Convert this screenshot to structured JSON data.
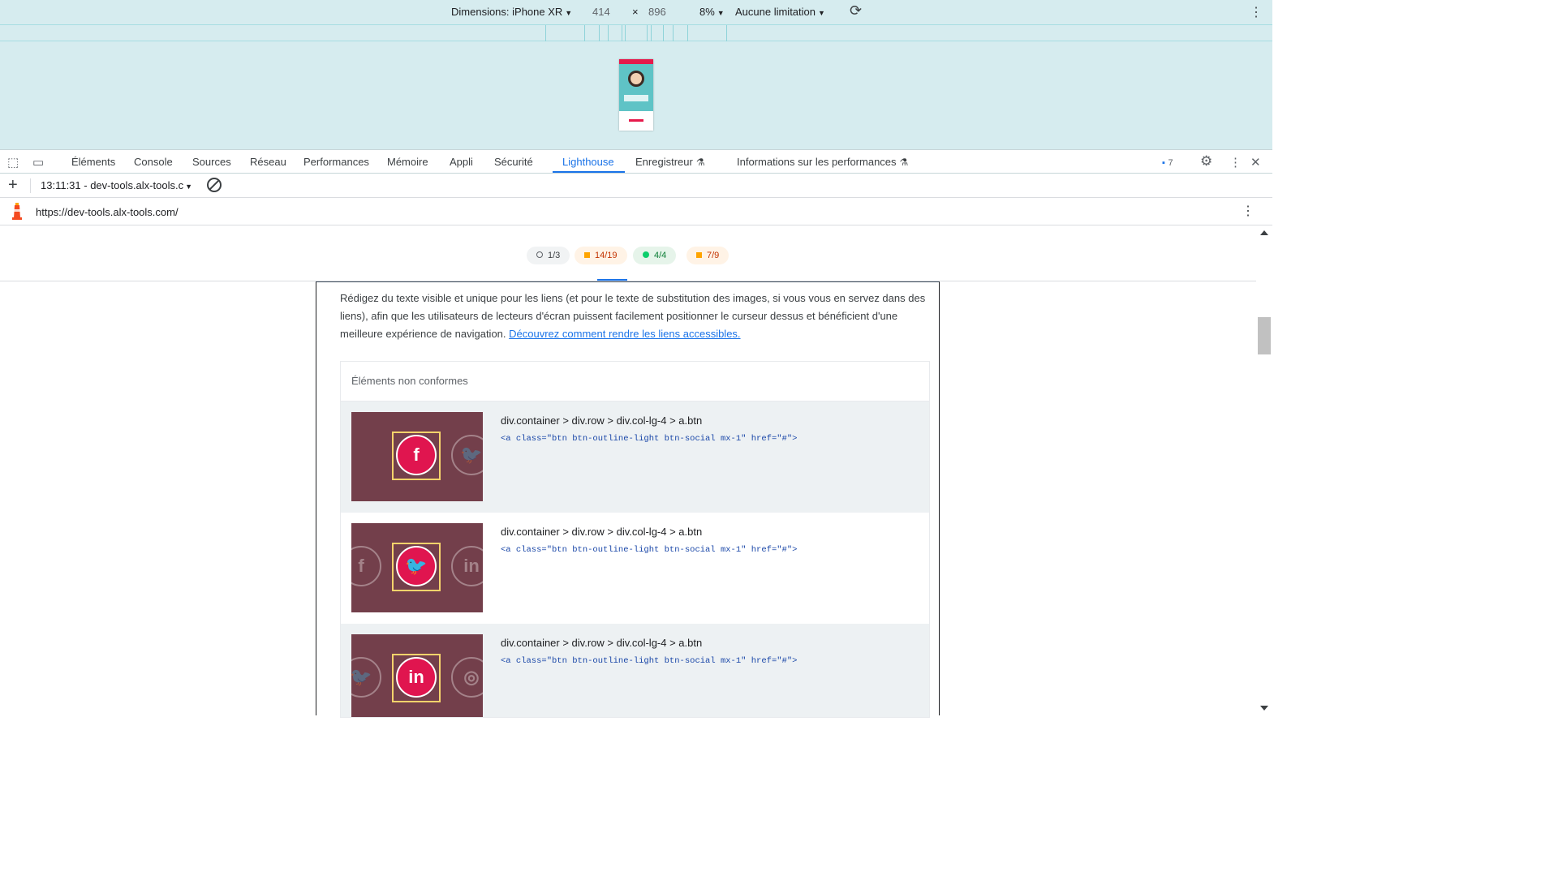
{
  "device_toolbar": {
    "dimensions_label": "Dimensions: iPhone XR",
    "width": "414",
    "times": "×",
    "height": "896",
    "zoom": "8%",
    "throttle": "Aucune limitation",
    "icons": [
      "rotate-icon",
      "more-vert-icon"
    ]
  },
  "tabs": [
    {
      "label": "Éléments"
    },
    {
      "label": "Console"
    },
    {
      "label": "Sources"
    },
    {
      "label": "Réseau"
    },
    {
      "label": "Performances"
    },
    {
      "label": "Mémoire"
    },
    {
      "label": "Appli"
    },
    {
      "label": "Sécurité"
    },
    {
      "label": "Lighthouse",
      "active": true
    },
    {
      "label": "Enregistreur"
    },
    {
      "label": "Informations sur les performances"
    }
  ],
  "issues_count": "7",
  "lighthouse_toolbar": {
    "report_select": "13:11:31 - dev-tools.alx-tools.c",
    "url": "https://dev-tools.alx-tools.com/"
  },
  "gauges": [
    {
      "label": "1/3",
      "kind": "neutral"
    },
    {
      "label": "14/19",
      "kind": "average"
    },
    {
      "label": "4/4",
      "kind": "pass"
    },
    {
      "label": "7/9",
      "kind": "average"
    }
  ],
  "colors": {
    "accent": "#1a73e8",
    "device_bg": "#d6ecef",
    "average": "#ffa400",
    "pass": "#0cce6b"
  },
  "audit": {
    "description": "Rédigez du texte visible et unique pour les liens (et pour le texte de substitution des images, si vous vous en servez dans des liens), afin que les utilisateurs de lecteurs d'écran puissent facilement positionner le curseur dessus et bénéficient d'une meilleure expérience de navigation.",
    "learn_more": "Découvrez comment rendre les liens accessibles.",
    "table_header": "Éléments non conformes",
    "items": [
      {
        "path": "div.container > div.row > div.col-lg-4 > a.btn",
        "snippet": "<a class=\"btn btn-outline-light btn-social mx-1\" href=\"#\">",
        "icon": "facebook-icon",
        "glyph": "f",
        "neighbors": [
          "",
          "twitter-icon"
        ]
      },
      {
        "path": "div.container > div.row > div.col-lg-4 > a.btn",
        "snippet": "<a class=\"btn btn-outline-light btn-social mx-1\" href=\"#\">",
        "icon": "twitter-icon",
        "glyph": "🐦",
        "neighbors": [
          "facebook-icon",
          "linkedin-icon"
        ]
      },
      {
        "path": "div.container > div.row > div.col-lg-4 > a.btn",
        "snippet": "<a class=\"btn btn-outline-light btn-social mx-1\" href=\"#\">",
        "icon": "linkedin-icon",
        "glyph": "in",
        "neighbors": [
          "twitter-icon",
          "dribbble-icon"
        ]
      }
    ]
  }
}
